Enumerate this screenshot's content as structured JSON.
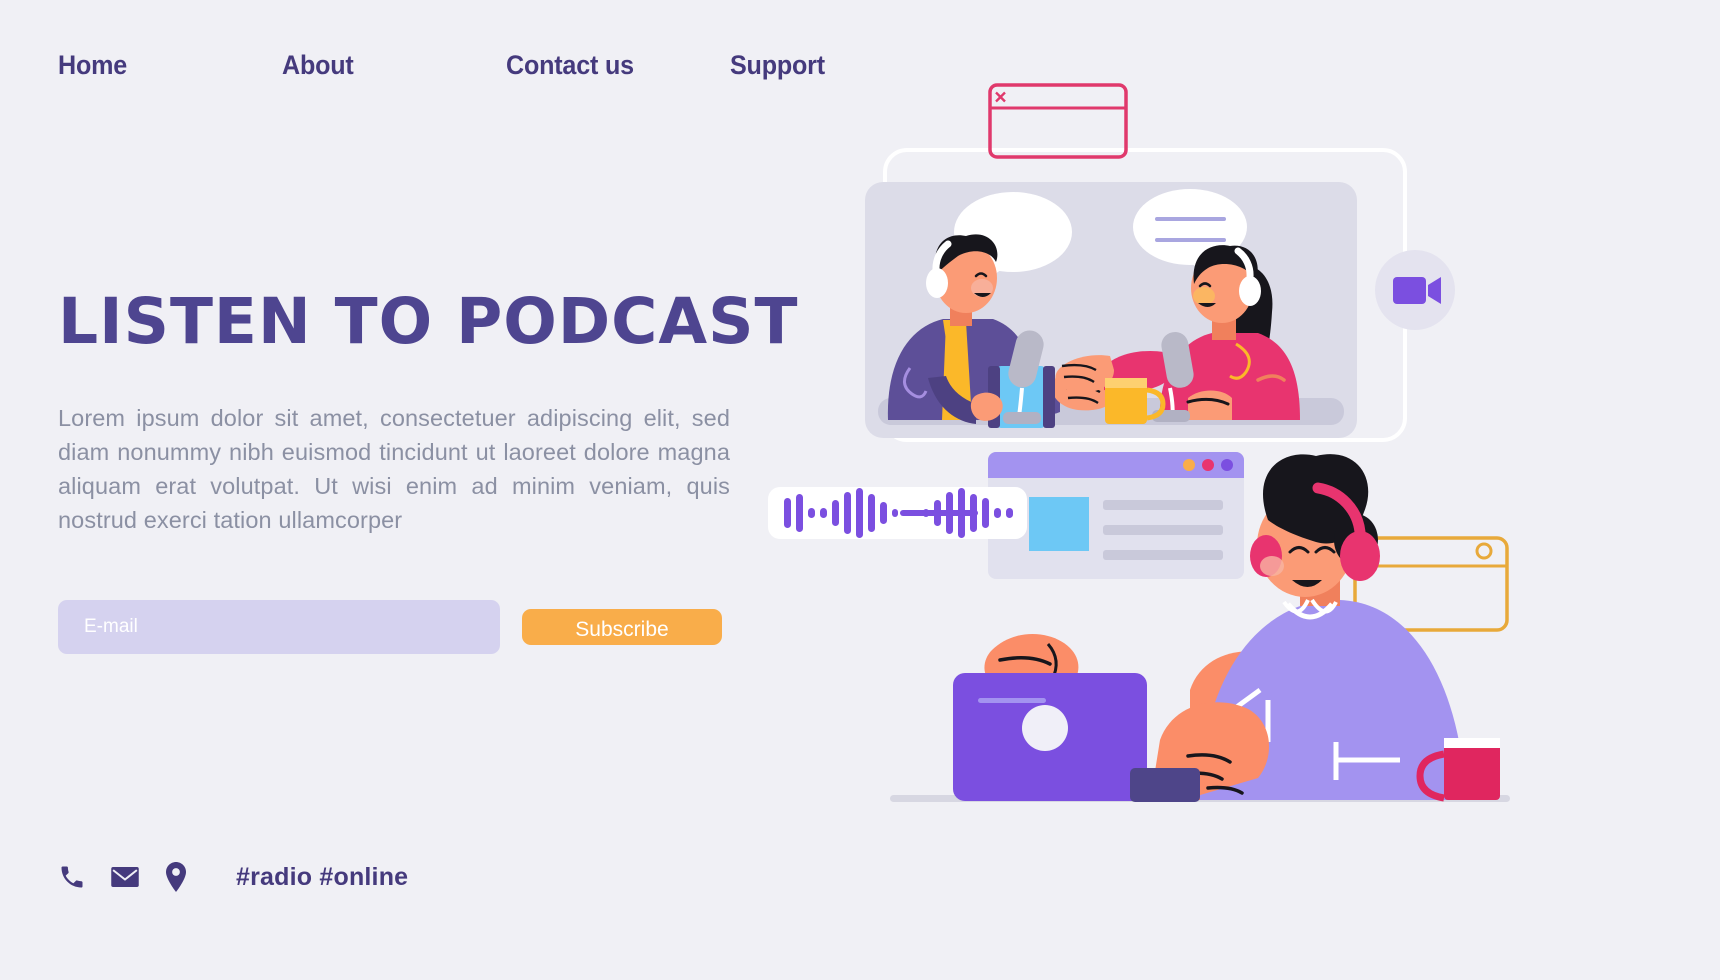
{
  "theme": {
    "background": "#f0f0f5",
    "primary_purple": "#453a7d",
    "heading_purple": "#4e4590",
    "body_gray": "#8b90a3",
    "input_lavender": "#d5d2ef",
    "accent_orange": "#f9ad4a",
    "accent_pink": "#e8346f",
    "accent_violet": "#7b4fe0",
    "panel_gray": "#dcdce8",
    "sky_blue": "#6dc8f5",
    "skin": "#f98f6e",
    "mug_orange": "#fbb829"
  },
  "nav": {
    "items": [
      {
        "label": "Home"
      },
      {
        "label": "About"
      },
      {
        "label": "Contact us"
      },
      {
        "label": "Support"
      }
    ]
  },
  "hero": {
    "headline": "LISTEN TO PODCAST",
    "paragraph": "Lorem ipsum dolor sit amet, consectetuer adipiscing elit, sed diam nonummy nibh euismod tincidunt ut laoreet dolore magna aliquam erat volutpat. Ut wisi enim ad minim veniam, quis nostrud exerci tation ullamcorper"
  },
  "form": {
    "email_placeholder": "E-mail",
    "email_value": "",
    "subscribe_label": "Subscribe"
  },
  "footer": {
    "icons": [
      {
        "name": "phone-icon"
      },
      {
        "name": "envelope-icon"
      },
      {
        "name": "location-pin-icon"
      }
    ],
    "hashtags": "#radio #online"
  },
  "illustration": {
    "pink_window": {
      "name": "pink-window-frame",
      "close_glyph": "✖"
    },
    "video_badge": {
      "name": "video-camera-icon"
    },
    "podcast_panel": {
      "name": "podcast-scene-panel",
      "speakers": [
        {
          "name": "speaker-left",
          "jacket": "#5d4f98",
          "shirt": "#fbb829",
          "bubble": "empty"
        },
        {
          "name": "speaker-right",
          "sweater": "#e8346f",
          "bubble": "two-lines"
        }
      ],
      "props": [
        "microphone-left",
        "microphone-right",
        "blue-tablet",
        "orange-mug"
      ]
    },
    "browser_card": {
      "name": "browser-window-card",
      "dots": [
        "#f9ad4a",
        "#e8346f",
        "#7b4fe0"
      ],
      "text_lines": 3
    },
    "waveform_card": {
      "name": "audio-waveform-card",
      "bar_color": "#7b4fe0"
    },
    "listener": {
      "name": "listener-with-headphones",
      "shirt": "#a393f0",
      "headphones": "#e8346f"
    },
    "laptop": {
      "name": "laptop",
      "color": "#7b4fe0"
    },
    "orange_window": {
      "name": "orange-window-frame"
    },
    "pink_mug": {
      "name": "pink-mug"
    }
  }
}
